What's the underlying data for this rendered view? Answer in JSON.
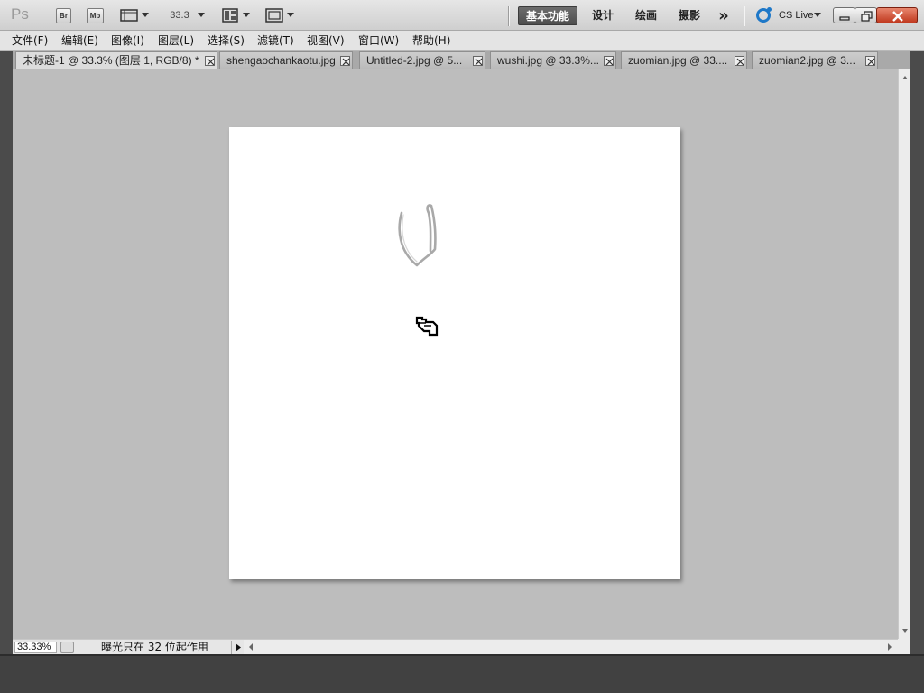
{
  "app": {
    "logo": "Ps",
    "bridge_label": "Br",
    "minibridge_label": "Mb",
    "zoom_value": "33.3"
  },
  "workspaces": {
    "essentials": "基本功能",
    "design": "设计",
    "painting": "绘画",
    "photography": "摄影",
    "more": "»"
  },
  "cslive": {
    "label": "CS Live"
  },
  "menu": [
    "文件(F)",
    "编辑(E)",
    "图像(I)",
    "图层(L)",
    "选择(S)",
    "滤镜(T)",
    "视图(V)",
    "窗口(W)",
    "帮助(H)"
  ],
  "tabs": [
    {
      "label": "未标题-1 @ 33.3% (图层 1, RGB/8) *",
      "active": true
    },
    {
      "label": "shengaochankaotu.jpg",
      "active": false
    },
    {
      "label": "Untitled-2.jpg @ 5...",
      "active": false
    },
    {
      "label": "wushi.jpg @ 33.3%...",
      "active": false
    },
    {
      "label": "zuomian.jpg @ 33....",
      "active": false
    },
    {
      "label": "zuomian2.jpg @ 3...",
      "active": false
    }
  ],
  "status": {
    "zoom": "33.33%",
    "message": "曝光只在 32 位起作用"
  },
  "colors": {
    "active_workspace": "#5a5a5a",
    "canvas": "#ffffff",
    "pasteboard": "#bdbdbd",
    "cslive_accent": "#1e78c8",
    "close_button": "#c9432a"
  },
  "icons": {
    "view_extras": "frame-icon",
    "arrange": "arrange-documents-icon",
    "screen_mode": "screen-mode-icon",
    "cursor": "smudge-tool-cursor-icon"
  }
}
